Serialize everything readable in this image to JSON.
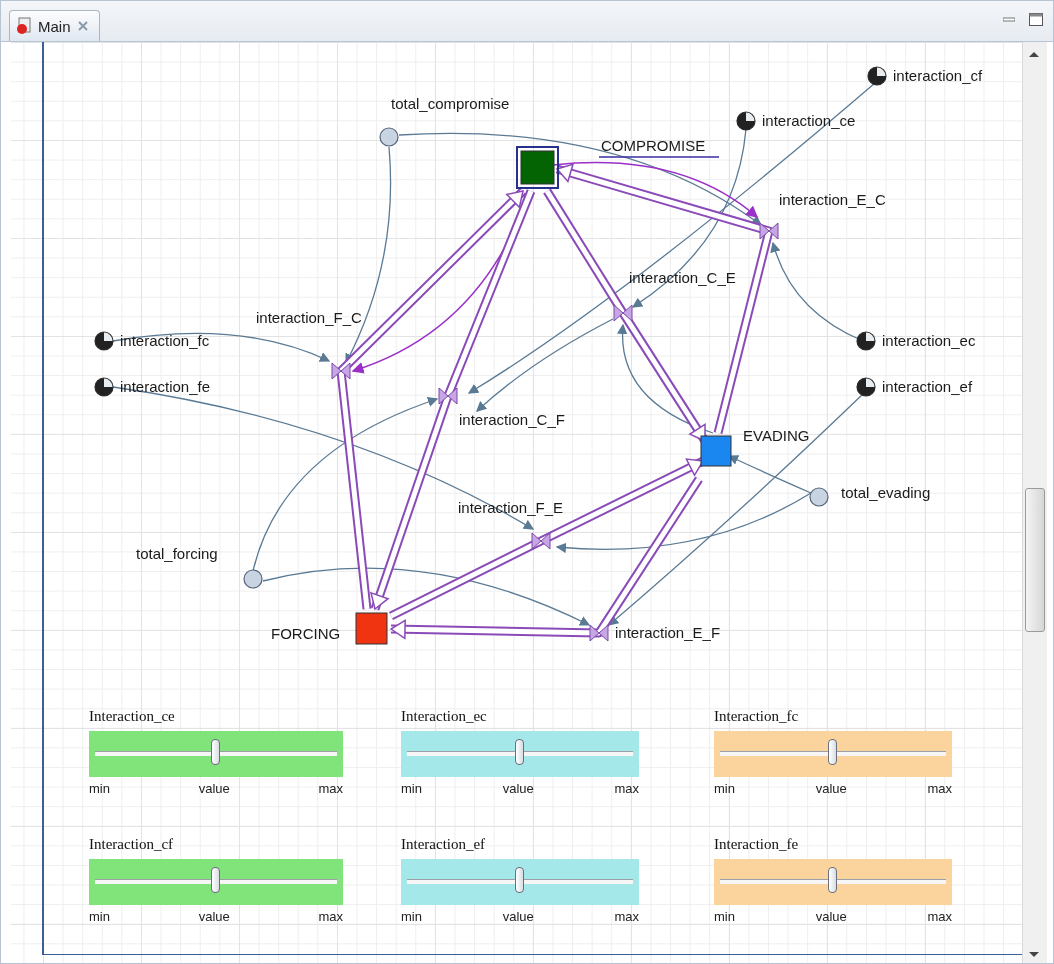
{
  "tab": {
    "title": "Main",
    "selected": true
  },
  "stocks": [
    {
      "name": "COMPROMISE",
      "color": "#046404",
      "selected": true
    },
    {
      "name": "EVADING",
      "color": "#1a86f0",
      "selected": false
    },
    {
      "name": "FORCING",
      "color": "#f03412",
      "selected": false
    }
  ],
  "flows": [
    {
      "name": "interaction_F_C"
    },
    {
      "name": "interaction_C_F"
    },
    {
      "name": "interaction_C_E"
    },
    {
      "name": "interaction_E_C"
    },
    {
      "name": "interaction_F_E"
    },
    {
      "name": "interaction_E_F"
    }
  ],
  "parameters": [
    {
      "name": "interaction_cf"
    },
    {
      "name": "interaction_ce"
    },
    {
      "name": "interaction_fc"
    },
    {
      "name": "interaction_fe"
    },
    {
      "name": "interaction_ec"
    },
    {
      "name": "interaction_ef"
    }
  ],
  "variables": [
    {
      "name": "total_compromise"
    },
    {
      "name": "total_evading"
    },
    {
      "name": "total_forcing"
    }
  ],
  "sliders": [
    {
      "label": "Interaction_ce",
      "color": "#80e47a",
      "level": 0.5,
      "min": "min",
      "value": "value",
      "max": "max"
    },
    {
      "label": "Interaction_ec",
      "color": "#a4e8ea",
      "level": 0.5,
      "min": "min",
      "value": "value",
      "max": "max"
    },
    {
      "label": "Interaction_fc",
      "color": "#fbd39c",
      "level": 0.5,
      "min": "min",
      "value": "value",
      "max": "max"
    },
    {
      "label": "Interaction_cf",
      "color": "#80e47a",
      "level": 0.5,
      "min": "min",
      "value": "value",
      "max": "max"
    },
    {
      "label": "Interaction_ef",
      "color": "#a4e8ea",
      "level": 0.5,
      "min": "min",
      "value": "value",
      "max": "max"
    },
    {
      "label": "Interaction_fe",
      "color": "#fbd39c",
      "level": 0.5,
      "min": "min",
      "value": "value",
      "max": "max"
    }
  ]
}
